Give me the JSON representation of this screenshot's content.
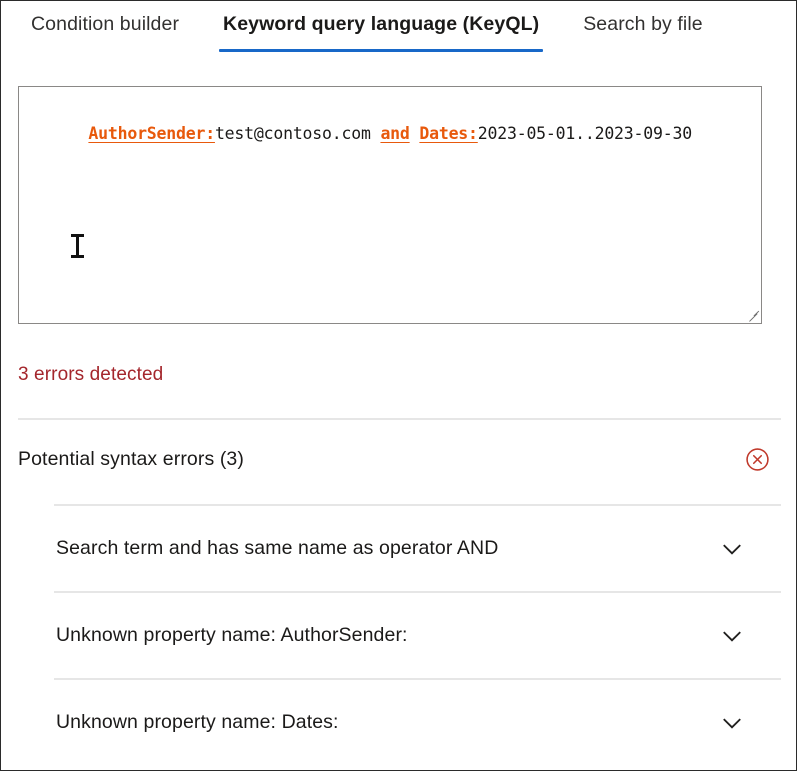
{
  "tabs": [
    {
      "label": "Condition builder",
      "active": false
    },
    {
      "label": "Keyword query language (KeyQL)",
      "active": true
    },
    {
      "label": "Search by file",
      "active": false
    }
  ],
  "query_editor": {
    "tokens": [
      {
        "text": "AuthorSender:",
        "kind": "property"
      },
      {
        "text": "test@contoso.com ",
        "kind": "plain"
      },
      {
        "text": "and",
        "kind": "operator"
      },
      {
        "text": " ",
        "kind": "plain"
      },
      {
        "text": "Dates:",
        "kind": "property"
      },
      {
        "text": "2023-05-01..2023-09-30",
        "kind": "plain"
      }
    ],
    "value": "AuthorSender:test@contoso.com and Dates:2023-05-01..2023-09-30",
    "placeholder": "",
    "resize_handle": "resize-grip-icon"
  },
  "errors_summary": "3 errors detected",
  "errors_section": {
    "title": "Potential syntax errors (3)",
    "status_icon": "error-circle-x-icon",
    "items": [
      {
        "label": "Search term and has same name as operator AND",
        "expand_icon": "chevron-down-icon"
      },
      {
        "label": "Unknown property name: AuthorSender:",
        "expand_icon": "chevron-down-icon"
      },
      {
        "label": "Unknown property name: Dates:",
        "expand_icon": "chevron-down-icon"
      }
    ]
  },
  "cursor": {
    "type": "i-beam-cursor"
  },
  "colors": {
    "accent": "#1868c8",
    "error_text": "#a4262c",
    "token_highlight": "#e8590c",
    "divider": "#e6e6e6",
    "text": "#1b1a19"
  }
}
